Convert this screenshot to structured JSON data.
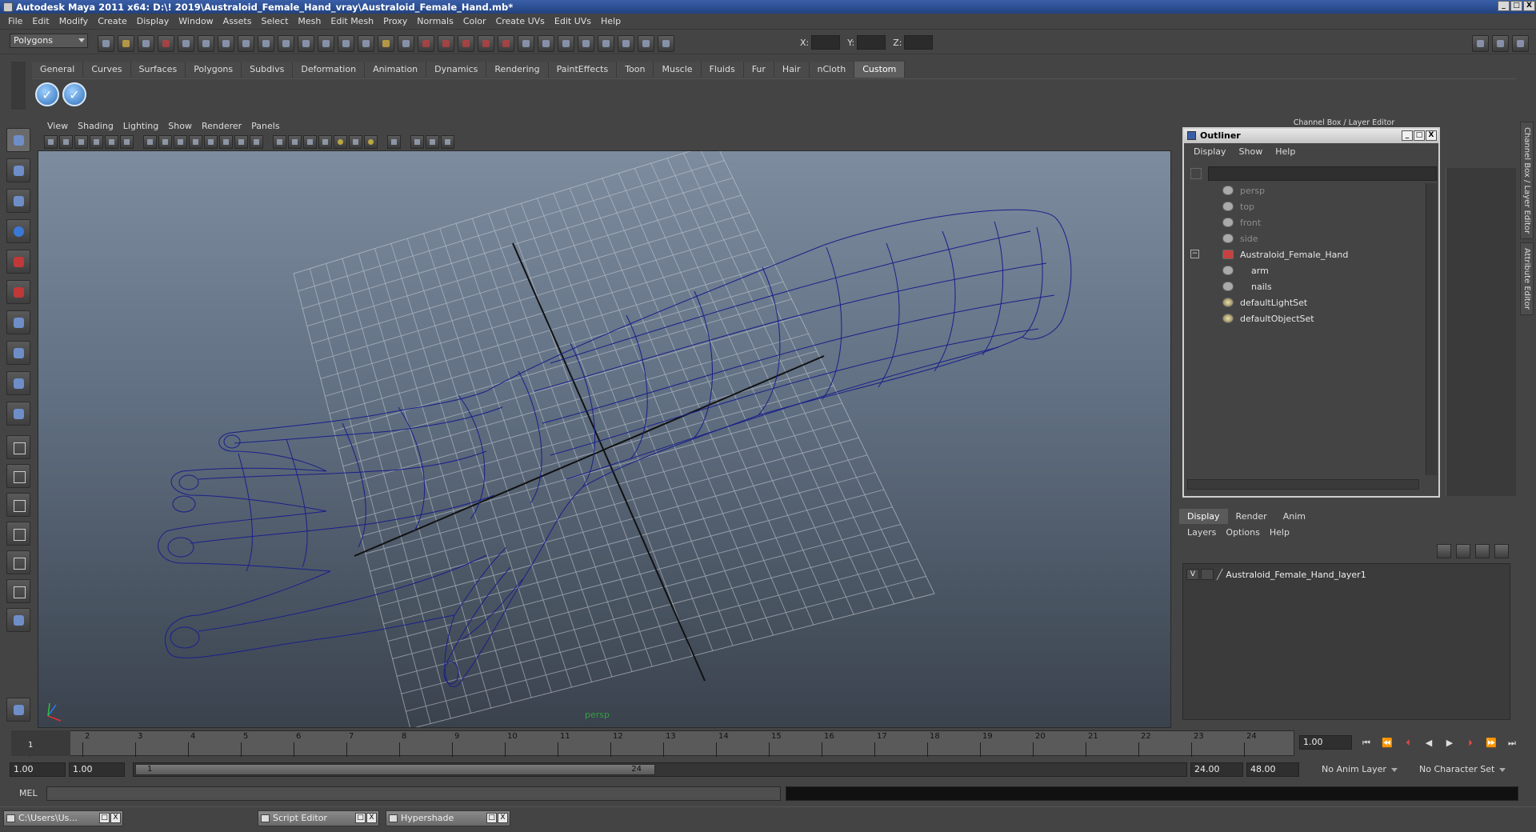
{
  "window": {
    "title": "Autodesk Maya 2011 x64: D:\\! 2019\\Australoid_Female_Hand_vray\\Australoid_Female_Hand.mb*",
    "controls": [
      "_",
      "□",
      "X"
    ]
  },
  "menubar": [
    "File",
    "Edit",
    "Modify",
    "Create",
    "Display",
    "Window",
    "Assets",
    "Select",
    "Mesh",
    "Edit Mesh",
    "Proxy",
    "Normals",
    "Color",
    "Create UVs",
    "Edit UVs",
    "Help"
  ],
  "statusline": {
    "mode": "Polygons",
    "x_label": "X:",
    "y_label": "Y:",
    "z_label": "Z:"
  },
  "shelf": {
    "tabs": [
      "General",
      "Curves",
      "Surfaces",
      "Polygons",
      "Subdivs",
      "Deformation",
      "Animation",
      "Dynamics",
      "Rendering",
      "PaintEffects",
      "Toon",
      "Muscle",
      "Fluids",
      "Fur",
      "Hair",
      "nCloth",
      "Custom"
    ],
    "active_tab": "Custom",
    "buttons": [
      "check-button",
      "check-button"
    ]
  },
  "viewport": {
    "menu": [
      "View",
      "Shading",
      "Lighting",
      "Show",
      "Renderer",
      "Panels"
    ],
    "camera_label": "persp",
    "wire_color": "#1a1f8a"
  },
  "channel_box_title": "Channel Box / Layer Editor",
  "side_tabs": [
    "Channel Box / Layer Editor",
    "Attribute Editor"
  ],
  "outliner": {
    "title": "Outliner",
    "menu": [
      "Display",
      "Show",
      "Help"
    ],
    "items": [
      {
        "label": "persp",
        "kind": "camera",
        "dim": true
      },
      {
        "label": "top",
        "kind": "camera",
        "dim": true
      },
      {
        "label": "front",
        "kind": "camera",
        "dim": true
      },
      {
        "label": "side",
        "kind": "camera",
        "dim": true
      },
      {
        "label": "Australoid_Female_Hand",
        "kind": "group",
        "dim": false
      },
      {
        "label": "arm",
        "kind": "mesh",
        "dim": false
      },
      {
        "label": "nails",
        "kind": "mesh",
        "dim": false
      },
      {
        "label": "defaultLightSet",
        "kind": "set",
        "dim": false
      },
      {
        "label": "defaultObjectSet",
        "kind": "set",
        "dim": false
      }
    ],
    "expand_toggle": "−"
  },
  "layer_editor": {
    "tabs": [
      "Display",
      "Render",
      "Anim"
    ],
    "active_tab": "Display",
    "menu": [
      "Layers",
      "Options",
      "Help"
    ],
    "layers": [
      {
        "visible": "V",
        "name": "Australoid_Female_Hand_layer1"
      }
    ]
  },
  "timeslider": {
    "current_frame": "1",
    "ticks": [
      "1",
      "2",
      "3",
      "4",
      "5",
      "6",
      "7",
      "8",
      "9",
      "10",
      "11",
      "12",
      "13",
      "14",
      "15",
      "16",
      "17",
      "18",
      "19",
      "20",
      "21",
      "22",
      "23",
      "24"
    ],
    "current_time": "1.00",
    "play_buttons": [
      "⏮",
      "⏪",
      "⏴",
      "◀",
      "▶",
      "⏵",
      "⏩",
      "⏭"
    ]
  },
  "range": {
    "start_time": "1.00",
    "playback_start": "1.00",
    "range_start": "1",
    "range_end": "24",
    "playback_end": "24.00",
    "end_time": "48.00",
    "anim_layer": "No Anim Layer",
    "character_set": "No Character Set"
  },
  "cmdline": {
    "label": "MEL"
  },
  "taskbar": [
    {
      "label": "C:\\Users\\Us..."
    },
    {
      "label": "Script Editor"
    },
    {
      "label": "Hypershade"
    }
  ],
  "colors": {
    "accent": "#3a5fa8",
    "wireframe": "#1a1f8a",
    "grid": "#c8ccd4"
  }
}
